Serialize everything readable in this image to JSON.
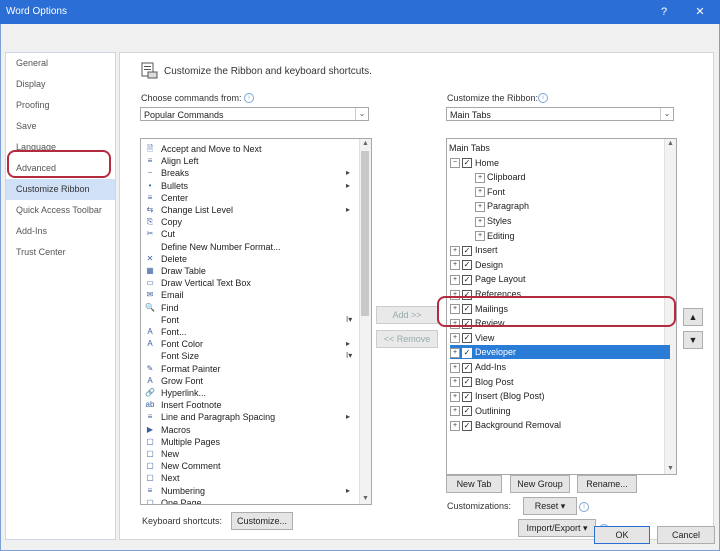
{
  "window": {
    "title": "Word Options",
    "help_label": "?",
    "close_label": "✕"
  },
  "sidebar": {
    "items": [
      {
        "label": "General"
      },
      {
        "label": "Display"
      },
      {
        "label": "Proofing"
      },
      {
        "label": "Save"
      },
      {
        "label": "Language"
      },
      {
        "label": "Advanced"
      },
      {
        "label": "Customize Ribbon",
        "selected": true
      },
      {
        "label": "Quick Access Toolbar"
      },
      {
        "label": "Add-Ins"
      },
      {
        "label": "Trust Center"
      }
    ]
  },
  "main": {
    "header": "Customize the Ribbon and keyboard shortcuts.",
    "choose_label": "Choose commands from:",
    "choose_value": "Popular Commands",
    "customize_label": "Customize the Ribbon:",
    "customize_value": "Main Tabs",
    "commands": [
      {
        "icon": "🗎",
        "label": "Accept and Move to Next"
      },
      {
        "icon": "≡",
        "label": "Align Left"
      },
      {
        "icon": "⎯",
        "label": "Breaks",
        "sub": "▸"
      },
      {
        "icon": "•",
        "label": "Bullets",
        "sub": "▸"
      },
      {
        "icon": "≡",
        "label": "Center"
      },
      {
        "icon": "⇆",
        "label": "Change List Level",
        "sub": "▸"
      },
      {
        "icon": "⎘",
        "label": "Copy"
      },
      {
        "icon": "✂",
        "label": "Cut"
      },
      {
        "icon": "",
        "label": "Define New Number Format..."
      },
      {
        "icon": "✕",
        "label": "Delete"
      },
      {
        "icon": "▦",
        "label": "Draw Table"
      },
      {
        "icon": "▭",
        "label": "Draw Vertical Text Box"
      },
      {
        "icon": "✉",
        "label": "Email"
      },
      {
        "icon": "🔍",
        "label": "Find"
      },
      {
        "icon": "",
        "label": "Font",
        "sub": "I▾"
      },
      {
        "icon": "A",
        "label": "Font..."
      },
      {
        "icon": "A",
        "label": "Font Color",
        "sub": "▸"
      },
      {
        "icon": "",
        "label": "Font Size",
        "sub": "I▾"
      },
      {
        "icon": "✎",
        "label": "Format Painter"
      },
      {
        "icon": "A",
        "label": "Grow Font"
      },
      {
        "icon": "🔗",
        "label": "Hyperlink..."
      },
      {
        "icon": "ab",
        "label": "Insert Footnote"
      },
      {
        "icon": "≡",
        "label": "Line and Paragraph Spacing",
        "sub": "▸"
      },
      {
        "icon": "▶",
        "label": "Macros"
      },
      {
        "icon": "▢",
        "label": "Multiple Pages"
      },
      {
        "icon": "▢",
        "label": "New"
      },
      {
        "icon": "▢",
        "label": "New Comment"
      },
      {
        "icon": "▢",
        "label": "Next"
      },
      {
        "icon": "≡",
        "label": "Numbering",
        "sub": "▸"
      },
      {
        "icon": "▢",
        "label": "One Page"
      }
    ],
    "add_button": "Add >>",
    "remove_button": "<< Remove",
    "tabs_tree": [
      {
        "label": "Main Tabs",
        "level": 0,
        "type": "header"
      },
      {
        "label": "Home",
        "level": 0,
        "expander": "⊟",
        "checked": true
      },
      {
        "label": "Clipboard",
        "level": 1,
        "expander": "⊞"
      },
      {
        "label": "Font",
        "level": 1,
        "expander": "⊞"
      },
      {
        "label": "Paragraph",
        "level": 1,
        "expander": "⊞"
      },
      {
        "label": "Styles",
        "level": 1,
        "expander": "⊞"
      },
      {
        "label": "Editing",
        "level": 1,
        "expander": "⊞"
      },
      {
        "label": "Insert",
        "level": 0,
        "expander": "⊞",
        "checked": true
      },
      {
        "label": "Design",
        "level": 0,
        "expander": "⊞",
        "checked": true
      },
      {
        "label": "Page Layout",
        "level": 0,
        "expander": "⊞",
        "checked": true
      },
      {
        "label": "References",
        "level": 0,
        "expander": "⊞",
        "checked": true
      },
      {
        "label": "Mailings",
        "level": 0,
        "expander": "⊞",
        "checked": true
      },
      {
        "label": "Review",
        "level": 0,
        "expander": "⊞",
        "checked": true
      },
      {
        "label": "View",
        "level": 0,
        "expander": "⊞",
        "checked": true
      },
      {
        "label": "Developer",
        "level": 0,
        "expander": "⊞",
        "checked": true,
        "selected": true
      },
      {
        "label": "Add-Ins",
        "level": 0,
        "expander": "⊞",
        "checked": true
      },
      {
        "label": "Blog Post",
        "level": 0,
        "expander": "⊞",
        "checked": true
      },
      {
        "label": "Insert (Blog Post)",
        "level": 0,
        "expander": "⊞",
        "checked": true
      },
      {
        "label": "Outlining",
        "level": 0,
        "expander": "⊞",
        "checked": true
      },
      {
        "label": "Background Removal",
        "level": 0,
        "expander": "⊞",
        "checked": true
      }
    ],
    "new_tab_button": "New Tab",
    "new_group_button": "New Group",
    "rename_button": "Rename...",
    "customizations_label": "Customizations:",
    "reset_button": "Reset ▾",
    "import_export_button": "Import/Export ▾",
    "keyboard_label": "Keyboard shortcuts:",
    "customize_button": "Customize...",
    "move_up": "▲",
    "move_down": "▼"
  },
  "footer": {
    "ok_button": "OK",
    "cancel_button": "Cancel"
  },
  "colors": {
    "titlebar": "#2b6fd6",
    "selection": "#2a7cd6",
    "highlight_ring": "#b42b3f"
  }
}
